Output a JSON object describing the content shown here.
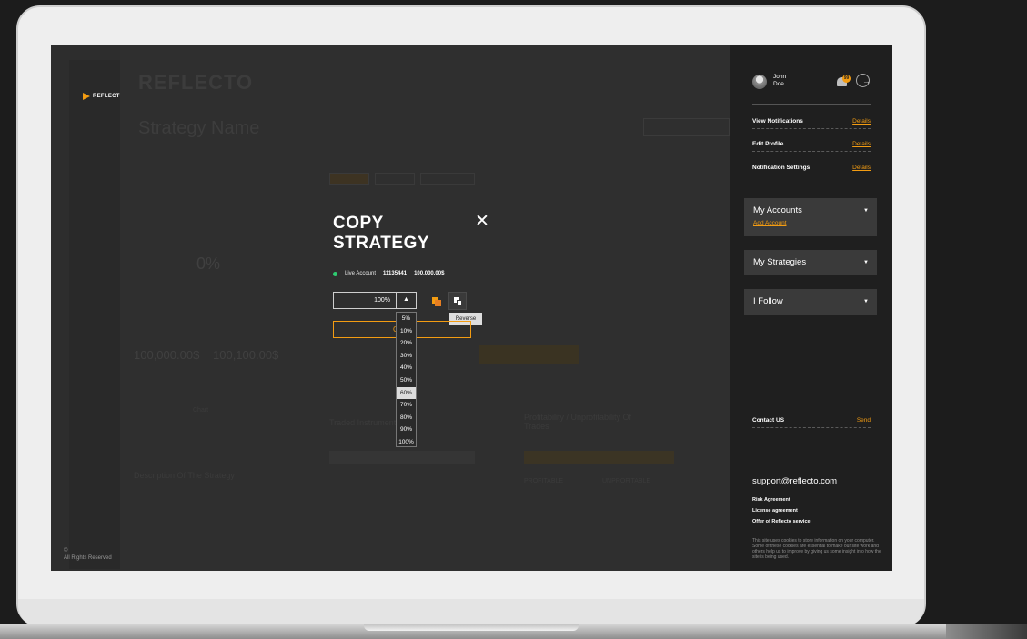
{
  "app": {
    "brand_small": "REFLECTO",
    "brand_large": "REFLECTO",
    "copyright": "©",
    "rights": "All Rights Reserved"
  },
  "background_page": {
    "title": "Strategy Name",
    "stat_percent": "0%",
    "balance_1": "100,000.00$",
    "balance_2": "100,100.00$",
    "chart_label": "Chart",
    "description_heading": "Description Of The Strategy",
    "profit_heading": "Profitability / Unprofitability Of Trades",
    "profitable": "PROFITABLE",
    "unprofitable": "UNPROFITABLE",
    "trades_label": "Traded Instruments"
  },
  "modal": {
    "title": "COPY STRATEGY",
    "close_symbol": "✕",
    "account_type": "Live Account",
    "account_id": "11135441",
    "account_balance": "100,000.00$",
    "percent_value": "100%",
    "percent_arrow": "▲",
    "reverse_tooltip": "Reverse",
    "confirm_partial": "C",
    "percent_options": [
      "5%",
      "10%",
      "20%",
      "30%",
      "40%",
      "50%",
      "60%",
      "70%",
      "80%",
      "90%",
      "100%"
    ],
    "highlighted_option": "60%"
  },
  "sidebar": {
    "user_first": "John",
    "user_last": "Doe",
    "notification_count": "99",
    "links": [
      {
        "label": "View Notifications",
        "action": "Details"
      },
      {
        "label": "Edit Profile",
        "action": "Details"
      },
      {
        "label": "Notification Settings",
        "action": "Details"
      }
    ],
    "my_accounts": "My Accounts",
    "add_account": "Add Account",
    "my_strategies": "My Strategies",
    "i_follow": "I Follow",
    "caret": "▼",
    "contact_label": "Contact US",
    "contact_action": "Send",
    "support_email": "support@reflecto.com",
    "legal": [
      "Risk Agreement",
      "License agreement",
      "Offer of Reflecto service"
    ],
    "cookie_text": "This site uses cookies to store information on your computer. Some of these cookies are essential to make our site work and others help us to improve by giving us some insight into how the site is being used."
  },
  "colors": {
    "accent": "#f39c12",
    "online": "#2ecc71"
  }
}
